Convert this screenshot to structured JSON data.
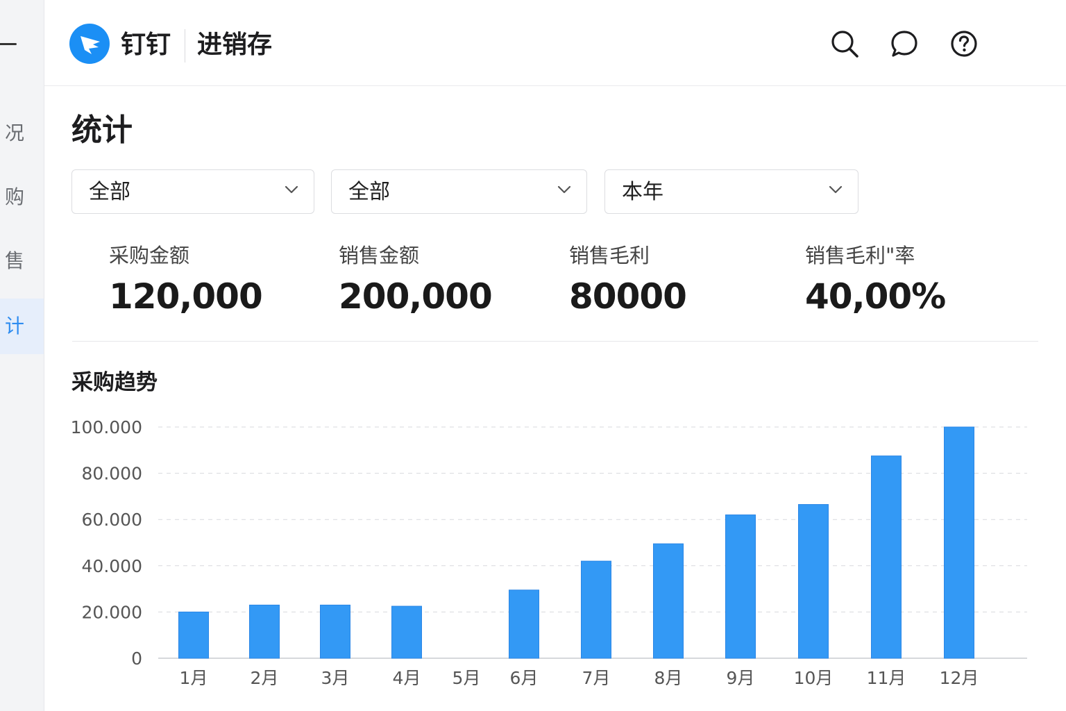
{
  "sidebar": {
    "items": [
      {
        "label": "况",
        "active": false
      },
      {
        "label": "购",
        "active": false
      },
      {
        "label": "售",
        "active": false
      },
      {
        "label": "计",
        "active": true
      }
    ]
  },
  "header": {
    "brand": "钉钉",
    "module": "进销存",
    "icons": [
      "search-icon",
      "chat-icon",
      "help-icon"
    ]
  },
  "page": {
    "title": "统计",
    "filters": [
      {
        "value": "全部"
      },
      {
        "value": "全部"
      },
      {
        "value": "本年"
      }
    ],
    "stats": [
      {
        "label": "采购金额",
        "value": "120,000"
      },
      {
        "label": "销售金额",
        "value": "200,000"
      },
      {
        "label": "销售毛利",
        "value": "80000"
      },
      {
        "label": "销售毛利\"率",
        "value": "40,00%"
      }
    ],
    "chart_title": "采购趋势"
  },
  "colors": {
    "accent": "#2e8cf0",
    "bar": "#3399f5",
    "sidebar_bg": "#f3f4f6"
  },
  "chart_data": {
    "type": "bar",
    "categories": [
      "1月",
      "2月",
      "3月",
      "4月",
      "5月",
      "6月",
      "7月",
      "8月",
      "9月",
      "10月",
      "11月",
      "12月"
    ],
    "values": [
      20000,
      23000,
      23000,
      22500,
      0,
      29500,
      42000,
      49500,
      62000,
      66500,
      87500,
      100000
    ],
    "yticks": [
      "0",
      "20.000",
      "40.000",
      "60.000",
      "80.000",
      "100.000"
    ],
    "ylim": [
      0,
      100000
    ],
    "grid": true,
    "title": "",
    "xlabel": "",
    "ylabel": ""
  }
}
